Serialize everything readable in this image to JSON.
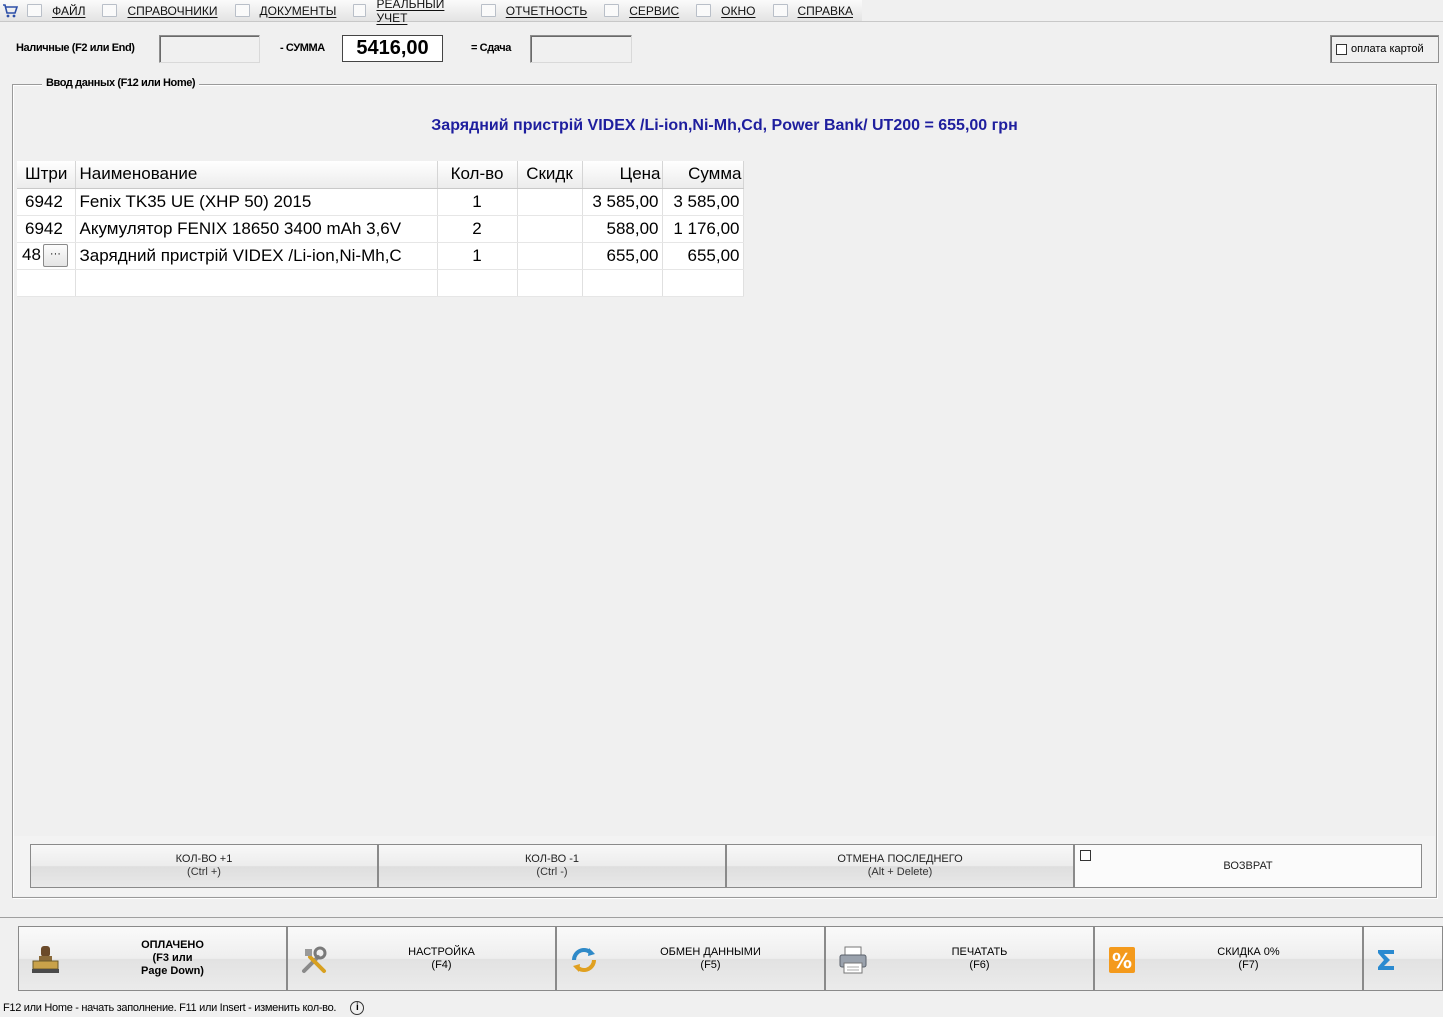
{
  "menu": {
    "items": [
      {
        "label": "ФАЙЛ",
        "icon": "folder-icon"
      },
      {
        "label": "СПРАВОЧНИКИ",
        "icon": "home-icon"
      },
      {
        "label": "ДОКУМЕНТЫ",
        "icon": "document-icon"
      },
      {
        "label": "РЕАЛЬНЫЙ УЧЕТ",
        "icon": "ledger-icon"
      },
      {
        "label": "ОТЧЕТНОСТЬ",
        "icon": "report-icon"
      },
      {
        "label": "СЕРВИС",
        "icon": "service-icon"
      },
      {
        "label": "ОКНО",
        "icon": "window-icon"
      },
      {
        "label": "СПРАВКА",
        "icon": "help-icon"
      }
    ]
  },
  "payment": {
    "cash_label": "Наличные (F2 или End)",
    "cash_value": "",
    "sum_label": "- СУММА",
    "sum_value": "5416,00",
    "change_label": "= Сдача",
    "change_value": "",
    "card_label": "оплата картой",
    "card_checked": false
  },
  "input_group": {
    "title": "Ввод данных (F12 или Home)",
    "last_item": "Зарядний пристрій VIDEX /Li-ion,Ni-Mh,Cd, Power Bank/ UT200   = 655,00 грн"
  },
  "table": {
    "columns": [
      "Штри",
      "Наименование",
      "Кол-во",
      "Скидк",
      "Цена",
      "Сумма"
    ],
    "rows": [
      {
        "code": "6942",
        "name": "Fenix TK35 UE (XHP 50) 2015",
        "qty": "1",
        "discount": "",
        "price": "3 585,00",
        "sum": "3 585,00"
      },
      {
        "code": "6942",
        "name": "Акумулятор FENIX 18650 3400 mAh 3,6V",
        "qty": "2",
        "discount": "",
        "price": "588,00",
        "sum": "1 176,00"
      },
      {
        "code": "48",
        "name": "Зарядний  пристрій VIDEX /Li-ion,Ni-Mh,C",
        "qty": "1",
        "discount": "",
        "price": "655,00",
        "sum": "655,00"
      }
    ],
    "ellipsis": "···"
  },
  "actions": {
    "qty_plus": {
      "line1": "КОЛ-ВО +1",
      "line2": "(Ctrl +)"
    },
    "qty_minus": {
      "line1": "КОЛ-ВО -1",
      "line2": "(Ctrl -)"
    },
    "cancel_last": {
      "line1": "ОТМЕНА ПОСЛЕДНЕГО",
      "line2": "(Alt + Delete)"
    },
    "return": {
      "label": "ВОЗВРАТ",
      "checked": false
    }
  },
  "toolbar": {
    "paid": {
      "line1": "ОПЛАЧЕНО",
      "line2": "(F3 или",
      "line3": "Page Down)",
      "icon": "stamp-icon"
    },
    "settings": {
      "line1": "НАСТРОЙКА",
      "line2": "(F4)",
      "icon": "tools-icon"
    },
    "exchange": {
      "line1": "ОБМЕН ДАННЫМИ",
      "line2": "(F5)",
      "icon": "refresh-icon"
    },
    "print": {
      "line1": "ПЕЧАТАТЬ",
      "line2": "(F6)",
      "icon": "printer-icon"
    },
    "discount": {
      "line1": "СКИДКА 0%",
      "line2": "(F7)",
      "icon": "percent-icon"
    },
    "sigma": {
      "icon": "sigma-icon"
    }
  },
  "status": {
    "text": "F12 или Home - начать заполнение. F11 или Insert - изменить кол-во."
  }
}
